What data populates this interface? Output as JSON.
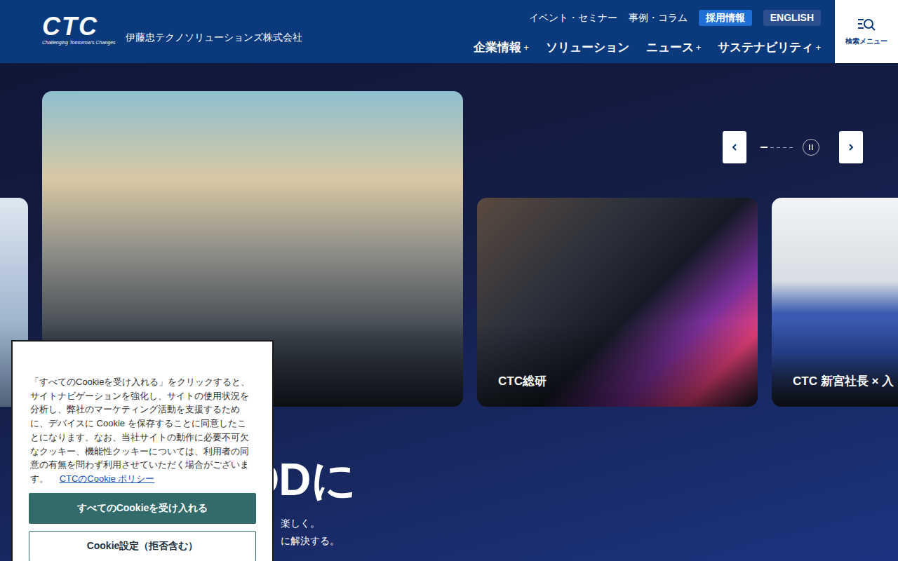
{
  "header": {
    "logo": "CTC",
    "logo_tagline": "Challenging Tomorrow's Changes",
    "company": "伊藤忠テクノソリューションズ株式会社",
    "top_links": [
      {
        "label": "イベント・セミナー",
        "kind": "link",
        "color": "#0a3a7c"
      },
      {
        "label": "事例・コラム",
        "kind": "link",
        "color": "#0a3a7c"
      },
      {
        "label": "採用情報",
        "kind": "badge",
        "color": "#1f6fd6"
      },
      {
        "label": "ENGLISH",
        "kind": "badge",
        "color": "#2b4f8f"
      }
    ],
    "nav_expand_mark": "+",
    "nav": [
      {
        "label": "企業情報",
        "expandable": true
      },
      {
        "label": "ソリューション",
        "expandable": false
      },
      {
        "label": "ニュース",
        "expandable": true
      },
      {
        "label": "サステナビリティ",
        "expandable": true
      }
    ],
    "search_label": "検索メニュー"
  },
  "carousel": {
    "slides": [
      {
        "caption": "世界をGOODに",
        "kind": "main"
      },
      {
        "caption": "CTC総研",
        "kind": "code"
      },
      {
        "caption": "CTC 新宮社長 × 入",
        "kind": "studio"
      }
    ],
    "indicators": [
      {
        "selected": true
      },
      {
        "selected": false
      },
      {
        "selected": false
      },
      {
        "selected": false
      },
      {
        "selected": false
      }
    ],
    "playing": true
  },
  "hero": {
    "title": "世界をGOODに",
    "lines": [
      "楽しく。",
      "に解決する。"
    ]
  },
  "cookie": {
    "text": "「すべてのCookieを受け入れる」をクリックすると、サイトナビゲーションを強化し、サイトの使用状況を分析し、弊社のマーケティング活動を支援するために、デバイスに Cookie を保存することに同意したことになります。なお、当社サイトの動作に必要不可欠なクッキー、機能性クッキーについては、利用者の同意の有無を問わず利用させていただく場合がございます。",
    "link": "CTCのCookie ポリシー",
    "accept": "すべてのCookieを受け入れる",
    "settings": "Cookie設定（拒否含む）"
  }
}
